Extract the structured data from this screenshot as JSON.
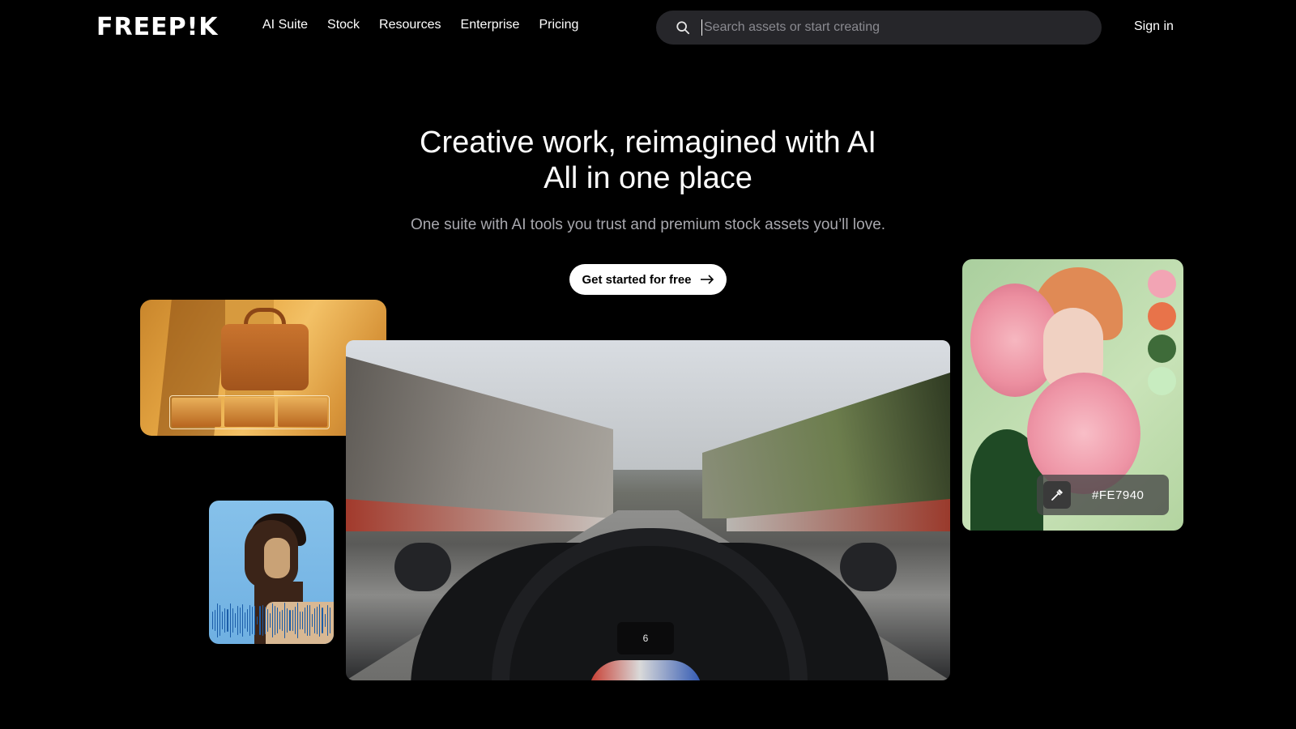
{
  "header": {
    "logo_text": "FREEP!K",
    "nav": [
      "AI Suite",
      "Stock",
      "Resources",
      "Enterprise",
      "Pricing"
    ],
    "search_placeholder": "Search assets or start creating",
    "signin_label": "Sign in"
  },
  "hero": {
    "title_line1": "Creative work, reimagined with AI",
    "title_line2": "All in one place",
    "subtitle": "One suite with AI tools you trust and premium stock assets you’ll love.",
    "cta_label": "Get started for free"
  },
  "color_picker": {
    "hex_label": "#FE7940",
    "swatches": [
      "#f2a4b4",
      "#e8734a",
      "#3e6b39",
      "#c8ecc0"
    ]
  },
  "video": {
    "dash_readout": "6"
  },
  "icons": {
    "search": "search-icon",
    "arrow": "arrow-right-icon",
    "eyedropper": "eyedropper-icon"
  }
}
